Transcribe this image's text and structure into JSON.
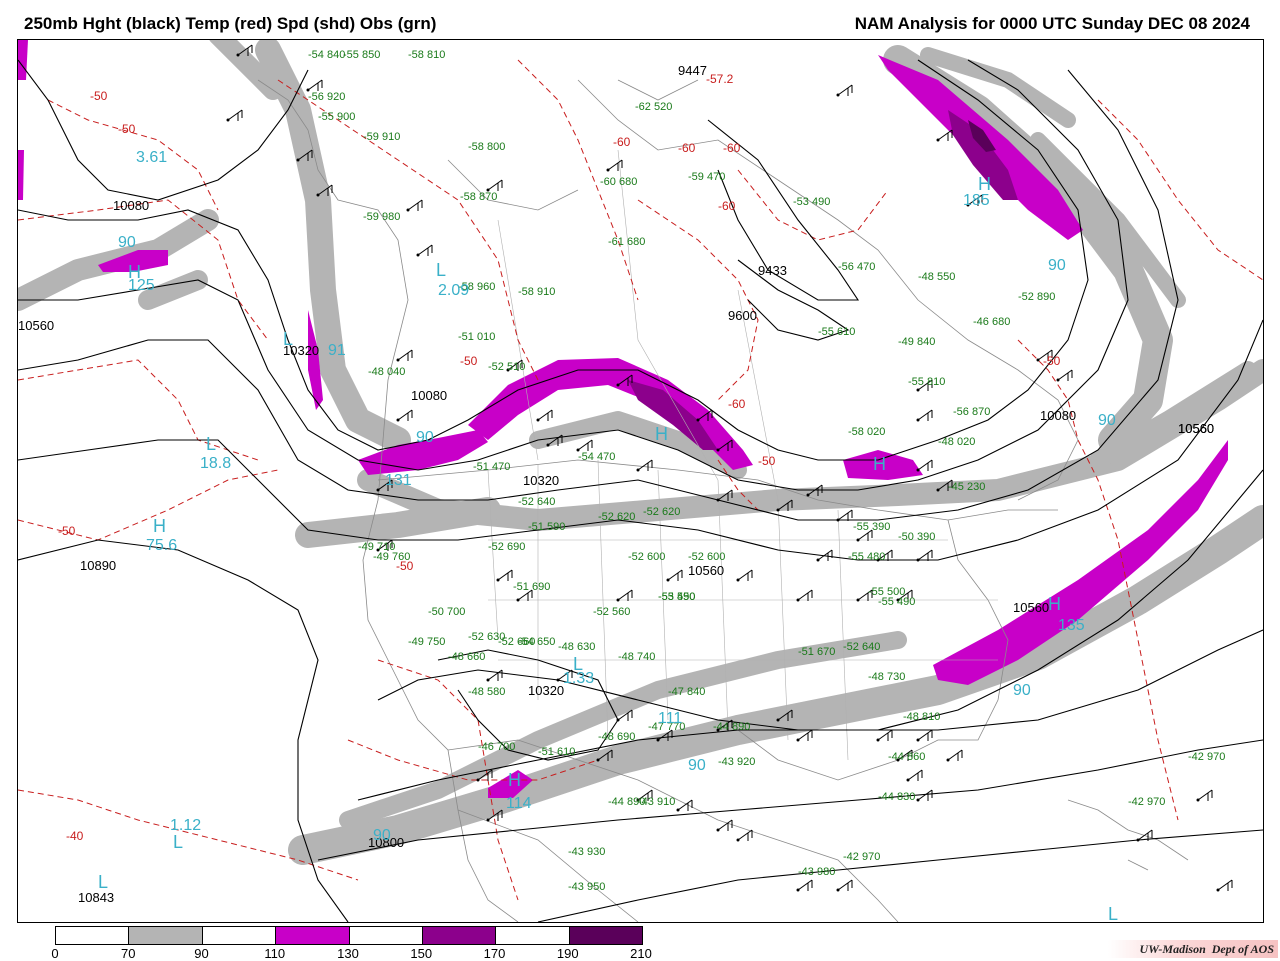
{
  "header": {
    "left_title": "250mb Hght (black) Temp (red) Spd (shd) Obs (grn)",
    "right_title": "NAM Analysis for 0000 UTC Sunday  DEC 08 2024"
  },
  "colors": {
    "height_contour": "#000000",
    "temp_contour": "#c81e1e",
    "obs_text": "#1a7a1a",
    "speed_label": "#3ab0c8",
    "spd_70_90": "#b4b4b4",
    "spd_110_130": "#c800c8",
    "spd_150_170": "#8c008c",
    "spd_190_210": "#5a005a",
    "background": "#ffffff"
  },
  "legend": {
    "ticks": [
      "0",
      "70",
      "90",
      "110",
      "130",
      "150",
      "170",
      "190",
      "210"
    ],
    "segment_colors": [
      "#ffffff",
      "#b4b4b4",
      "#ffffff",
      "#c800c8",
      "#ffffff",
      "#8c008c",
      "#ffffff",
      "#5a005a"
    ]
  },
  "height_labels": [
    "9447",
    "9433",
    "9600",
    "10080",
    "10080",
    "10320",
    "10320",
    "10560",
    "10560",
    "10560",
    "10560",
    "10560",
    "10890",
    "10800",
    "10843",
    "10320",
    "10080"
  ],
  "temp_labels": [
    "-50",
    "-50",
    "-60",
    "-60",
    "-60",
    "-60",
    "-57.2",
    "-50",
    "-50",
    "-50",
    "-50",
    "-40",
    "-50",
    "-60"
  ],
  "speed_labels": [
    "3.61",
    "90",
    "125",
    "2.09",
    "91",
    "18.8",
    "75.6",
    "90",
    "131",
    "185",
    "90",
    "90",
    "90",
    "135",
    "90",
    "1.33",
    "111",
    "114",
    "1.12",
    "90"
  ],
  "high_low_letters": [
    "L",
    "H",
    "L",
    "H",
    "L",
    "H",
    "H",
    "H",
    "H",
    "L",
    "L",
    "L",
    "H",
    "L"
  ],
  "obs_samples": [
    "-54 840",
    "-55 850",
    "-58 810",
    "-56 920",
    "-55 900",
    "-59 910",
    "-58 800",
    "-60 680",
    "-59 470",
    "-53 490",
    "-56 470",
    "-62 520",
    "-58 870",
    "-61 680",
    "-59 980",
    "-58 960",
    "-58 910",
    "-51 010",
    "-48 040",
    "-52 510",
    "-51 470",
    "-54 470",
    "-52 620",
    "-52 640",
    "-51 590",
    "-52 620",
    "-52 600",
    "-52 600",
    "-53 590",
    "-52 560",
    "-49 710",
    "-50 700",
    "-52 630",
    "-48 580",
    "-48 660",
    "-48 630",
    "-48 740",
    "-46 700",
    "-51 610",
    "-48 690",
    "-47 770",
    "-47 840",
    "-44 890",
    "-43 920",
    "-44 830",
    "-44 860",
    "-44 890",
    "-43 910",
    "-43 930",
    "-43 950",
    "-42 960",
    "-44 980",
    "-43 980",
    "-42 970",
    "-42 970",
    "-42 970",
    "-41 990",
    "-48 550",
    "-46 680",
    "-55 610",
    "-49 840",
    "-55 810",
    "-56 870",
    "-52 890",
    "-58 020",
    "-48 020",
    "-45 230",
    "-50 390",
    "-55 390",
    "-55 480",
    "-55 500",
    "-55 490",
    "-52 640",
    "-51 670",
    "-48 730",
    "-48 810",
    "-49 760",
    "-52 690",
    "-51 690",
    "-49 750",
    "-52 660",
    "-54 650",
    "-55 450"
  ],
  "credit": {
    "org": "UW-Madison",
    "dept": "Dept of AOS"
  }
}
